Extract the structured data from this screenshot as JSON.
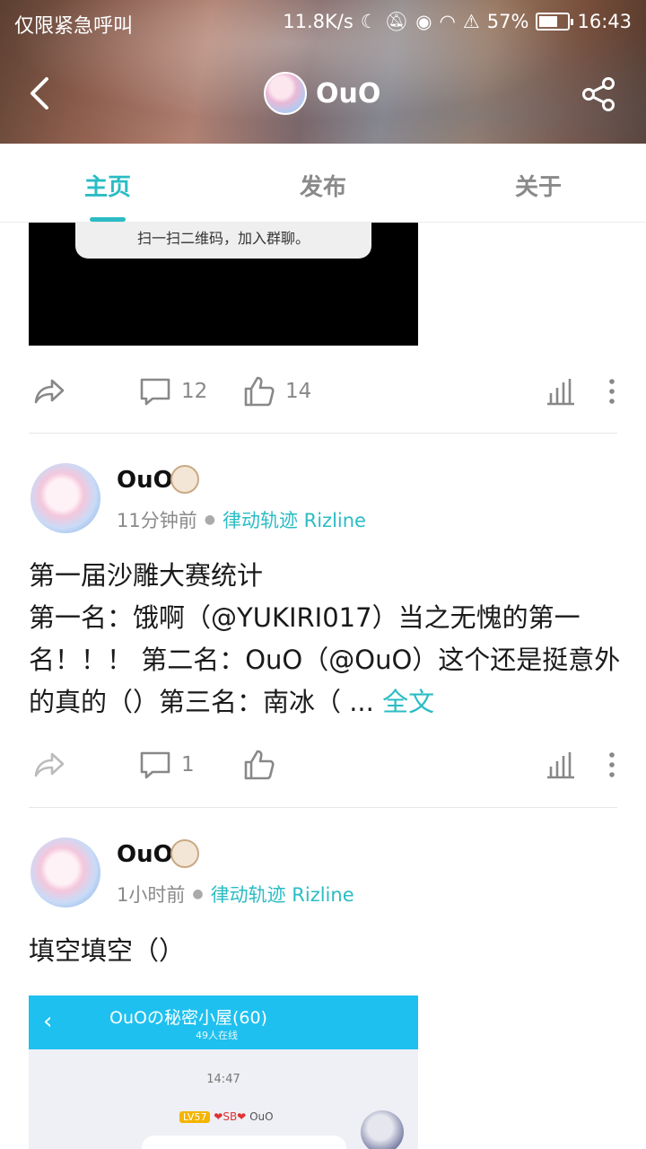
{
  "status_bar": {
    "carrier": "仅限紧急呼叫",
    "speed": "11.8K/s",
    "battery": "57%",
    "time": "16:43",
    "icons": [
      "moon-icon",
      "mute-icon",
      "eye-icon",
      "wifi-icon",
      "alert-icon",
      "battery-icon"
    ]
  },
  "nav": {
    "title": "OuO",
    "back_icon": "chevron-left-icon",
    "share_icon": "share-icon"
  },
  "tabs": [
    {
      "label": "主页",
      "active": true
    },
    {
      "label": "发布",
      "active": false
    },
    {
      "label": "关于",
      "active": false
    }
  ],
  "post0": {
    "image_caption": "扫一扫二维码，加入群聊。",
    "comments": "12",
    "likes": "14"
  },
  "post1": {
    "author": "OuO",
    "time": "11分钟前",
    "topic": "律动轨迹 Rizline",
    "text": "第一届沙雕大赛统计\n第一名：饿啊（@YUKIRI017）当之无愧的第一名！！！ 第二名：OuO（@OuO）这个还是挺意外的真的（）第三名：南冰（ ...",
    "more": "全文",
    "comments": "1"
  },
  "post2": {
    "author": "OuO",
    "time": "1小时前",
    "topic": "律动轨迹 Rizline",
    "text": "填空填空（）",
    "chat": {
      "title": "OuOの秘密小屋(60)",
      "online": "49人在线",
      "time": "14:47",
      "level": "LV57",
      "tag": "❤SB❤",
      "user": "OuO"
    }
  },
  "colors": {
    "accent": "#2bbcc5",
    "chat_header": "#1ec0ef"
  }
}
